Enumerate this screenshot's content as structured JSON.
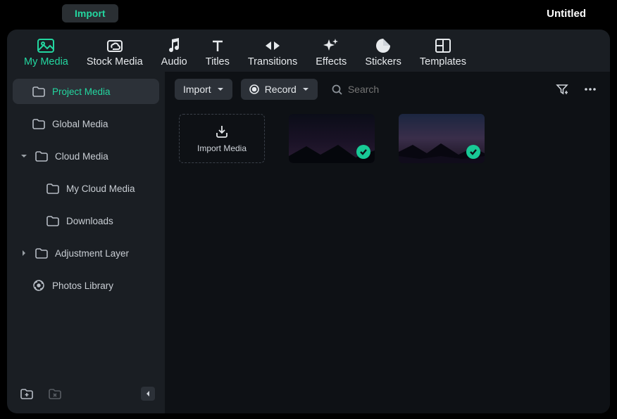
{
  "topbar": {
    "import_tab": "Import",
    "project_title": "Untitled"
  },
  "tabs": {
    "my_media": "My Media",
    "stock_media": "Stock Media",
    "audio": "Audio",
    "titles": "Titles",
    "transitions": "Transitions",
    "effects": "Effects",
    "stickers": "Stickers",
    "templates": "Templates"
  },
  "sidebar": {
    "project_media": "Project Media",
    "global_media": "Global Media",
    "cloud_media": "Cloud Media",
    "my_cloud_media": "My Cloud Media",
    "downloads": "Downloads",
    "adjustment_layer": "Adjustment Layer",
    "photos_library": "Photos Library"
  },
  "toolbar": {
    "import": "Import",
    "record": "Record",
    "search_placeholder": "Search"
  },
  "grid": {
    "import_media": "Import Media"
  }
}
